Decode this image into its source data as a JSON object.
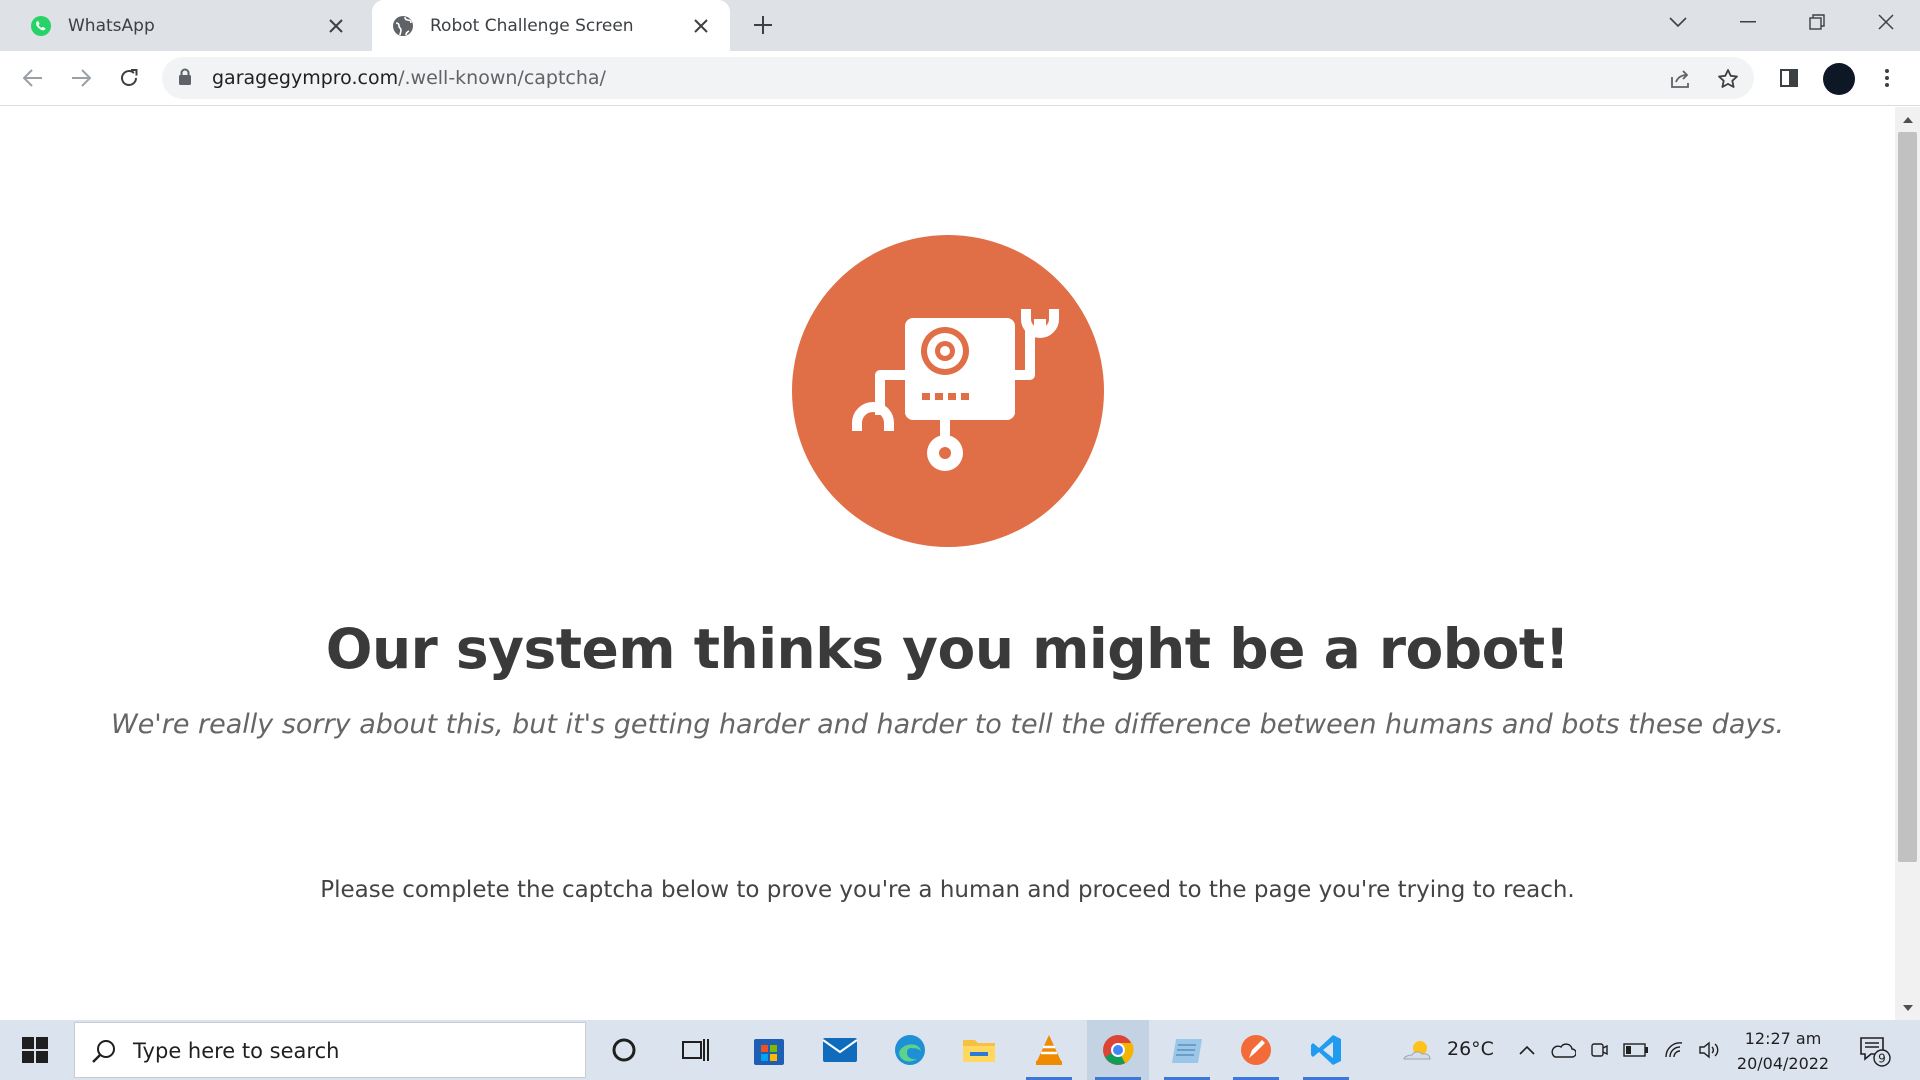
{
  "browser": {
    "tabs": [
      {
        "label": "WhatsApp",
        "icon": "whatsapp-icon",
        "active": false
      },
      {
        "label": "Robot Challenge Screen",
        "icon": "globe-icon",
        "active": true
      }
    ],
    "address_bar": {
      "domain": "garagegympro.com",
      "path": "/.well-known/captcha/"
    }
  },
  "page": {
    "accent_color": "#e06e47",
    "headline": "Our system thinks you might be a robot!",
    "subline": "We're really sorry about this, but it's getting harder and harder to tell the difference between humans and bots these days.",
    "instruction": "Please complete the captcha below to prove you're a human and proceed to the page you're trying to reach."
  },
  "taskbar": {
    "search_placeholder": "Type here to search",
    "temperature": "26°C",
    "time": "12:27 am",
    "date": "20/04/2022",
    "notification_count": "9",
    "apps": [
      "cortana-icon",
      "task-view-icon",
      "store-icon",
      "mail-icon",
      "edge-icon",
      "file-explorer-icon",
      "vlc-icon",
      "chrome-icon",
      "notepad-icon",
      "pen-app-icon",
      "vscode-icon"
    ]
  }
}
